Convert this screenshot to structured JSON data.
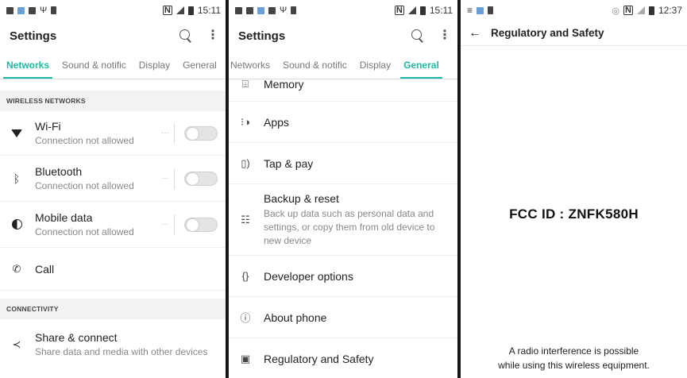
{
  "panel1": {
    "status_time": "15:11",
    "title": "Settings",
    "tabs": [
      "Networks",
      "Sound & notific",
      "Display",
      "General"
    ],
    "active_tab": 0,
    "section1": "WIRELESS NETWORKS",
    "wifi": {
      "title": "Wi-Fi",
      "subtitle": "Connection not allowed"
    },
    "bluetooth": {
      "title": "Bluetooth",
      "subtitle": "Connection not allowed"
    },
    "mobile_data": {
      "title": "Mobile data",
      "subtitle": "Connection not allowed"
    },
    "call": {
      "title": "Call"
    },
    "section2": "CONNECTIVITY",
    "share": {
      "title": "Share & connect",
      "subtitle": "Share data and media with other devices"
    }
  },
  "panel2": {
    "status_time": "15:11",
    "title": "Settings",
    "tabs": [
      "Networks",
      "Sound & notific",
      "Display",
      "General"
    ],
    "active_tab": 3,
    "memory": "Memory",
    "apps": "Apps",
    "tap_pay": "Tap & pay",
    "backup": {
      "title": "Backup & reset",
      "subtitle": "Back up data such as personal data and settings, or copy them from old device to new device"
    },
    "developer": "Developer options",
    "about": "About phone",
    "regulatory": "Regulatory and Safety"
  },
  "panel3": {
    "status_time": "12:37",
    "title": "Regulatory and Safety",
    "fcc": "FCC ID : ZNFK580H",
    "note_line1": "A radio interference is possible",
    "note_line2": "while using this wireless equipment."
  },
  "colors": {
    "accent": "#1fb8a2"
  }
}
